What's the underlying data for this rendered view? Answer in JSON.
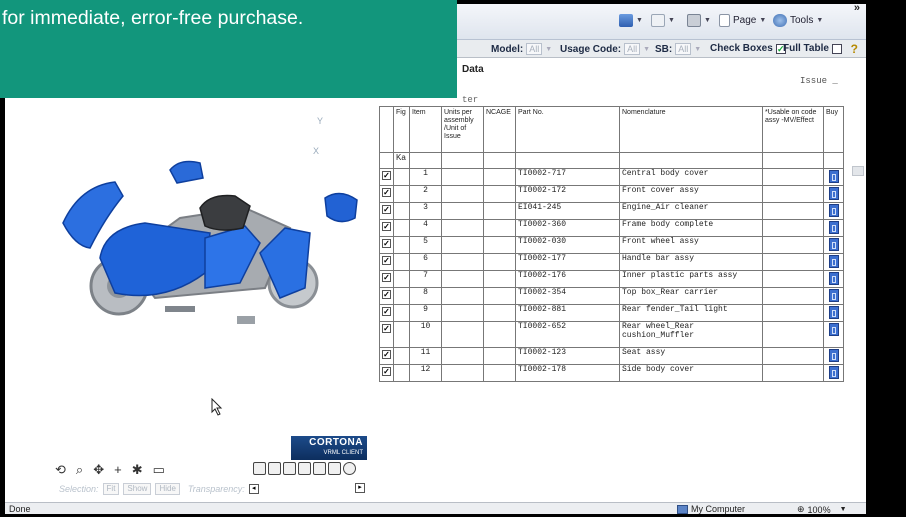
{
  "browser": {
    "commands": {
      "page": "Page",
      "tools": "Tools",
      "chevron": "»"
    },
    "status": {
      "done": "Done",
      "zone": "My Computer",
      "zoom": "100%"
    }
  },
  "filterbar": {
    "model_label": "Model:",
    "model_value": "All",
    "usage_label": "Usage Code:",
    "usage_value": "All",
    "sb_label": "SB:",
    "sb_value": "All",
    "checkboxes_label": "Check Boxes",
    "fulltable_label": "Full Table"
  },
  "header": {
    "title": "Data",
    "issue": "Issue _",
    "ter": "ter"
  },
  "viewer": {
    "axis_y": "Y",
    "axis_x": "X",
    "logo_line1": "CORTONA",
    "logo_line2": "VRML CLIENT",
    "selection_label": "Selection:",
    "fit_label": "Fit",
    "show_label": "Show",
    "hide_label": "Hide",
    "transparency_label": "Transparency:"
  },
  "table": {
    "headers": {
      "fig": "Fig",
      "item": "Item",
      "units": "Units per assembly /Unit of Issue",
      "ncage": "NCAGE",
      "partno": "Part No.",
      "nomenclature": "Nomenclature",
      "usable": "*Usable on code assy -MV/Effect",
      "buy": "Buy"
    },
    "fig_value": "Ka",
    "rows": [
      {
        "item": "1",
        "partno": "TI0002-717",
        "name": "Central body cover"
      },
      {
        "item": "2",
        "partno": "TI0002-172",
        "name": "Front cover assy"
      },
      {
        "item": "3",
        "partno": "EI041-245",
        "name": "Engine_Air cleaner"
      },
      {
        "item": "4",
        "partno": "TI0002-360",
        "name": "Frame body complete"
      },
      {
        "item": "5",
        "partno": "TI0002-030",
        "name": "Front wheel assy"
      },
      {
        "item": "6",
        "partno": "TI0002-177",
        "name": "Handle bar assy"
      },
      {
        "item": "7",
        "partno": "TI0002-176",
        "name": "Inner plastic parts assy"
      },
      {
        "item": "8",
        "partno": "TI0002-354",
        "name": "Top box_Rear carrier"
      },
      {
        "item": "9",
        "partno": "TI0002-881",
        "name": "Rear fender_Tail light"
      },
      {
        "item": "10",
        "partno": "TI0002-652",
        "name": "Rear wheel_Rear cushion_Muffler"
      },
      {
        "item": "11",
        "partno": "TI0002-123",
        "name": "Seat assy"
      },
      {
        "item": "12",
        "partno": "TI0002-178",
        "name": "Side body cover"
      }
    ]
  },
  "caption": {
    "text": "for immediate, error-free purchase."
  },
  "colors": {
    "caption_bg": "#12967c",
    "buy_button": "#3c6fcf",
    "model_blue": "#1f63d8"
  }
}
